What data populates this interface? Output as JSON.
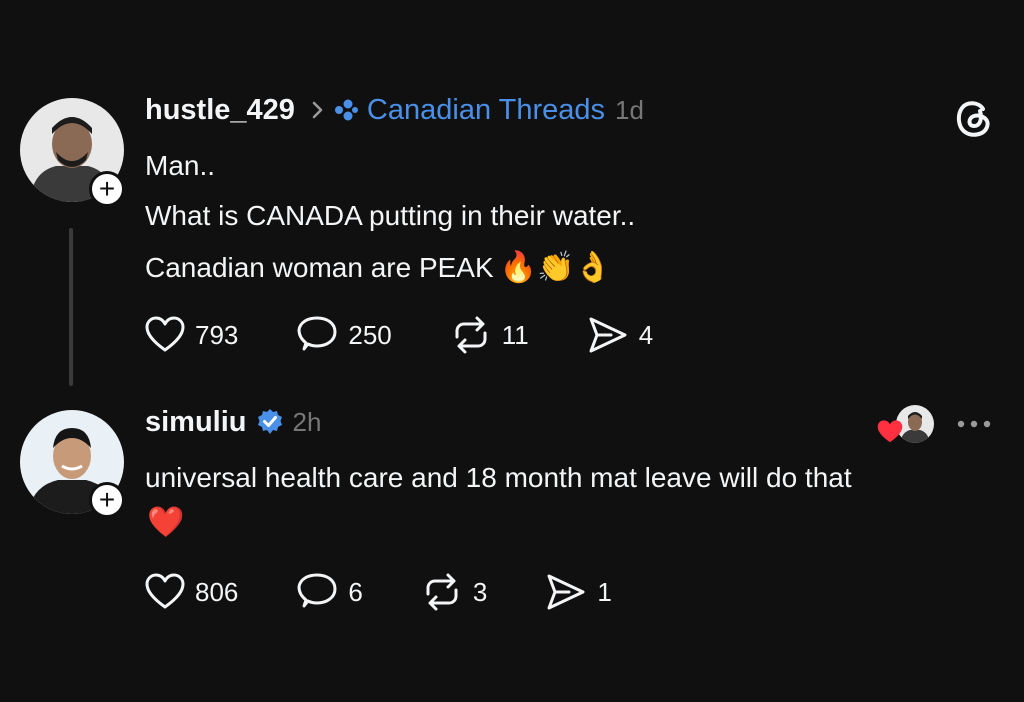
{
  "post": {
    "username": "hustle_429",
    "community": "Canadian Threads",
    "time": "1d",
    "lines": [
      "Man..",
      "What is CANADA putting in their water..",
      "Canadian woman are PEAK"
    ],
    "emojis": "🔥👏👌",
    "likes": "793",
    "replies": "250",
    "reposts": "11",
    "shares": "4"
  },
  "reply": {
    "username": "simuliu",
    "verified": true,
    "time": "2h",
    "text": "universal health care and 18 month mat leave will do that",
    "emoji": "❤️",
    "likes": "806",
    "replies": "6",
    "reposts": "3",
    "shares": "1"
  },
  "icons": {
    "threads_logo": "threads-logo-icon",
    "heart": "heart-icon",
    "comment": "comment-icon",
    "repost": "repost-icon",
    "share": "share-icon",
    "more": "more-icon",
    "verified": "verified-badge-icon",
    "chevron": "chevron-right-icon",
    "community": "community-icon"
  },
  "colors": {
    "background": "#101010",
    "text": "#f3f5f7",
    "muted": "#777777",
    "accent": "#4a90e8",
    "heart": "#ff3040"
  }
}
